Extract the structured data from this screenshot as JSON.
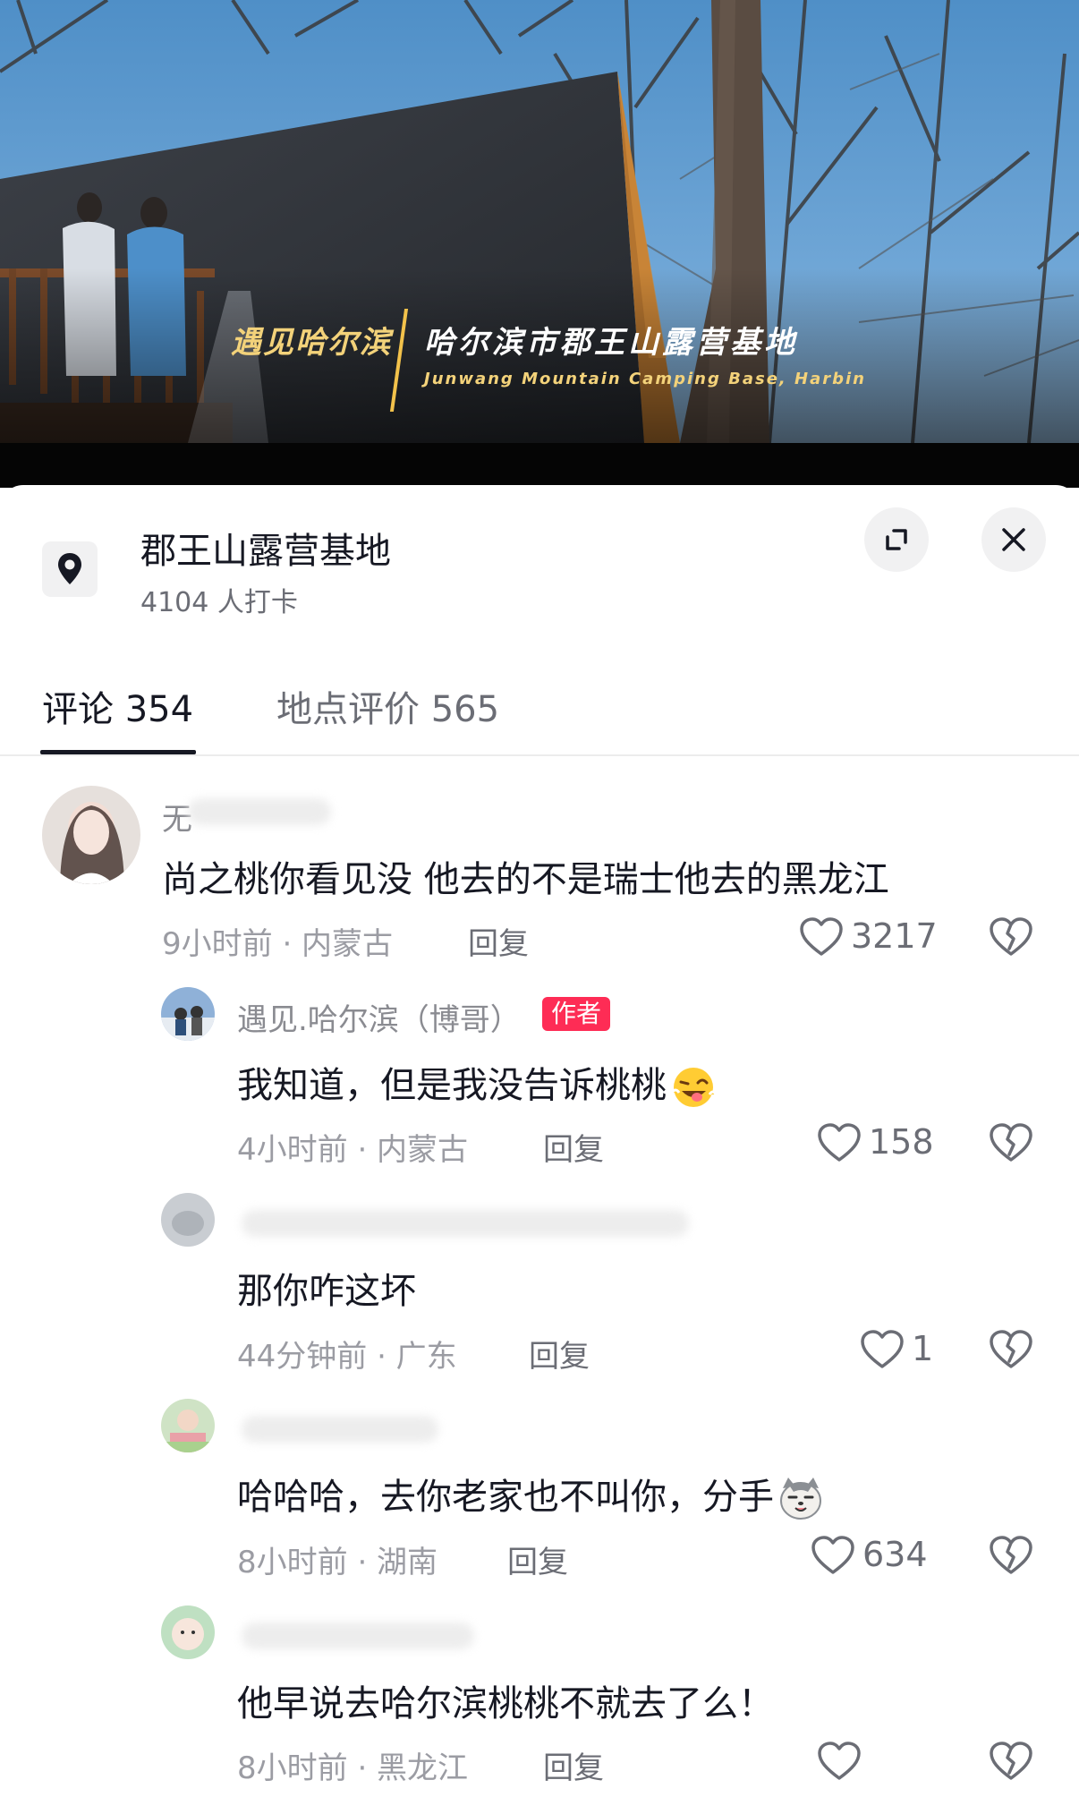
{
  "video": {
    "caption_left": "遇见哈尔滨",
    "caption_title": "哈尔滨市郡王山露营基地",
    "caption_en": "Junwang Mountain Camping Base, Harbin"
  },
  "location": {
    "name": "郡王山露营基地",
    "checkins": "4104 人打卡"
  },
  "tabs": {
    "comments": "评论 354",
    "reviews": "地点评价 565"
  },
  "comments": [
    {
      "author": "无",
      "text": "尚之桃你看见没 他去的不是瑞士他去的黑龙江",
      "time_loc": "9小时前 · 内蒙古",
      "reply": "回复",
      "likes": "3217"
    },
    {
      "author": "遇见.哈尔滨（博哥）",
      "badge": "作者",
      "text": "我知道，但是我没告诉桃桃",
      "time_loc": "4小时前 · 内蒙古",
      "reply": "回复",
      "likes": "158"
    },
    {
      "author": "",
      "text": "那你咋这坏",
      "time_loc": "44分钟前 · 广东",
      "reply": "回复",
      "likes": "1"
    },
    {
      "author": "",
      "text": "哈哈哈，去你老家也不叫你，分手",
      "time_loc": "8小时前 · 湖南",
      "reply": "回复",
      "likes": "634"
    },
    {
      "author": "",
      "text": "他早说去哈尔滨桃桃不就去了么！",
      "time_loc": "8小时前 · 黑龙江",
      "reply": "回复",
      "likes": ""
    }
  ],
  "colors": {
    "accent_red": "#fe2c55",
    "text_primary": "#161823",
    "text_secondary": "#9b9ca3"
  }
}
